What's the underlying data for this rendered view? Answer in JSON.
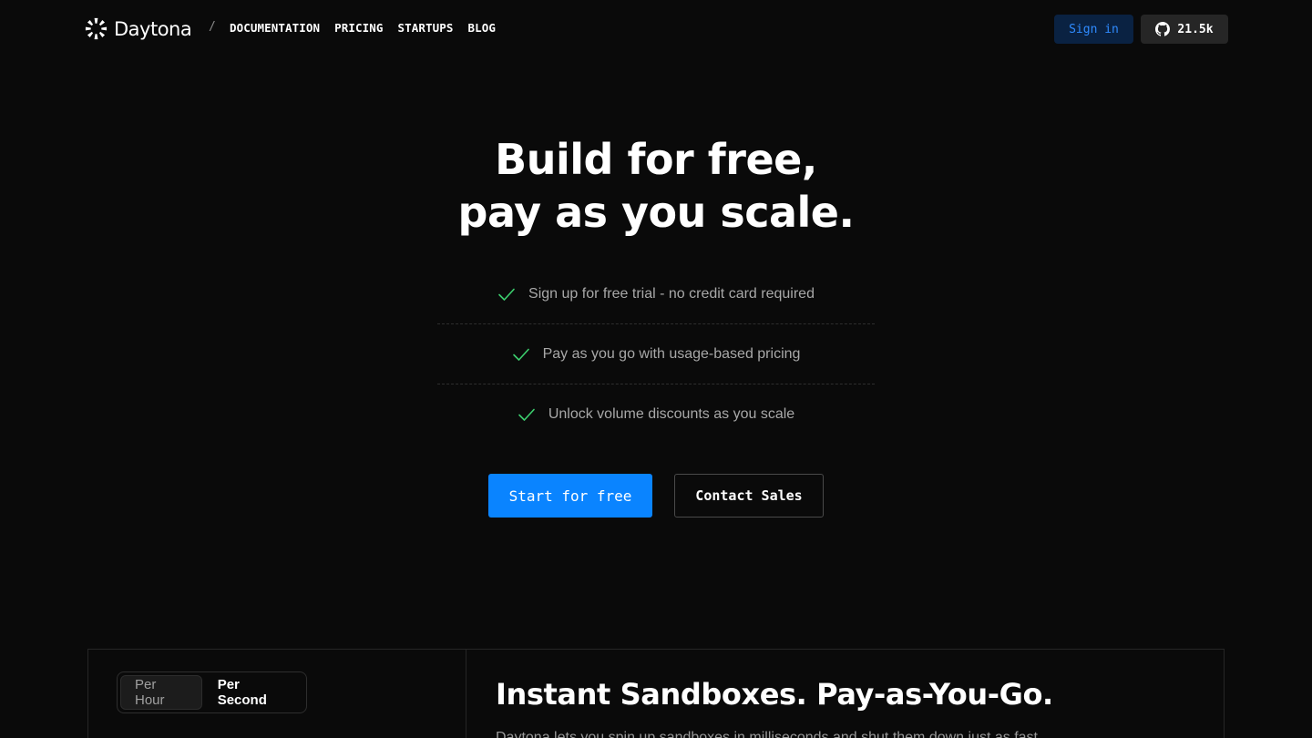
{
  "header": {
    "logo_text": "Daytona",
    "separator": "/",
    "nav": [
      {
        "label": "DOCUMENTATION"
      },
      {
        "label": "PRICING"
      },
      {
        "label": "STARTUPS"
      },
      {
        "label": "BLOG"
      }
    ],
    "signin_label": "Sign in",
    "github_stars": "21.5k",
    "icons": {
      "logo": "daytona-logo-icon",
      "github": "github-icon"
    }
  },
  "hero": {
    "title_line1": "Build for free,",
    "title_line2": "pay as you scale.",
    "benefits": [
      {
        "text": "Sign up for free trial - no credit card required",
        "icon": "check-icon"
      },
      {
        "text": "Pay as you go with usage-based pricing",
        "icon": "check-icon"
      },
      {
        "text": "Unlock volume discounts as you scale",
        "icon": "check-icon"
      }
    ],
    "cta_primary": "Start for free",
    "cta_secondary": "Contact Sales"
  },
  "pricing": {
    "toggle": {
      "options": [
        "Per Hour",
        "Per Second"
      ],
      "selected": "Per Second"
    },
    "title": "Instant Sandboxes. Pay-as-You-Go.",
    "description": "Daytona lets you spin up sandboxes in milliseconds and shut them down just as fast."
  },
  "colors": {
    "background": "#0a0a0a",
    "accent": "#0a84ff",
    "signin_bg": "#0a2242",
    "signin_text": "#2f8bff",
    "check": "#3ccf6e",
    "muted_text": "#a8a8a8"
  }
}
